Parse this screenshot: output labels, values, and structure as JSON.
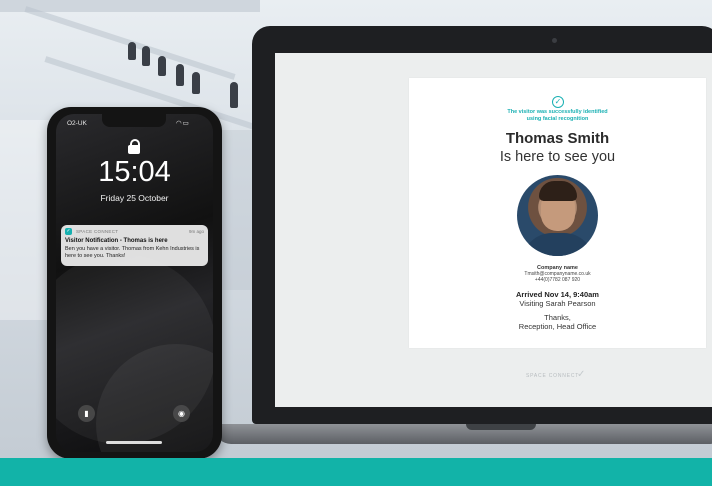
{
  "colors": {
    "accent": "#12b3a8",
    "teal_text": "#1ab0b3",
    "notification_bg": "#ececec"
  },
  "phone": {
    "carrier": "O2-UK",
    "status_icons": "wifi-icon battery-icon",
    "lock_icon": "lock-icon",
    "time": "15:04",
    "date": "Friday 25 October",
    "notification": {
      "app_icon": "space-connect-icon",
      "app_name": "SPACE CONNECT",
      "time_ago": "9m ago",
      "title": "Visitor Notification - Thomas is here",
      "body": "Ben you have a visitor. Thomas from Kehn Industries is here to see you. Thanks!"
    },
    "flashlight_icon": "flashlight-icon",
    "camera_icon": "camera-icon"
  },
  "laptop": {
    "card": {
      "check_icon": "check-circle-icon",
      "identified_line1": "The visitor was successfully identified",
      "identified_line2": "using facial recognition",
      "visitor_name": "Thomas Smith",
      "subtitle": "Is here to see you",
      "company_name": "Company name",
      "email": "Tmsith@companyname.co.uk",
      "phone": "+44(0)7782 087 920",
      "arrived": "Arrived Nov 14, 9:40am",
      "visiting": "Visiting Sarah Pearson",
      "thanks_line1": "Thanks,",
      "thanks_line2": "Reception, Head Office"
    },
    "brand": "SPACE CONNECT"
  }
}
